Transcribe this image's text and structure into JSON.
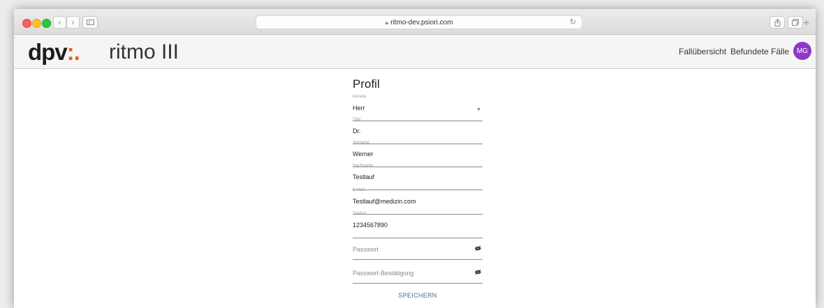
{
  "browser": {
    "url": "ritmo-dev.psiori.com"
  },
  "header": {
    "logo_text": "dpv",
    "logo_dots": ":.",
    "app_title": "ritmo III",
    "nav": [
      "Fallübersicht",
      "Befundete Fälle"
    ],
    "avatar_initials": "MG",
    "avatar_color": "#8e39c8"
  },
  "form": {
    "title": "Profil",
    "fields": [
      {
        "label": "Anrede",
        "value": "Herr"
      },
      {
        "label": "Titel",
        "value": "Dr."
      },
      {
        "label": "Vorname",
        "value": "Werner"
      },
      {
        "label": "Nachname",
        "value": "Testlauf"
      },
      {
        "label": "E-Mail",
        "value": "Testlauf@medizin.com"
      },
      {
        "label": "Telefon",
        "value": "1234567890"
      }
    ],
    "password_placeholder": "Passwort",
    "password_confirm_placeholder": "Passwort-Bestätigung",
    "save_label": "SPEICHERN"
  }
}
